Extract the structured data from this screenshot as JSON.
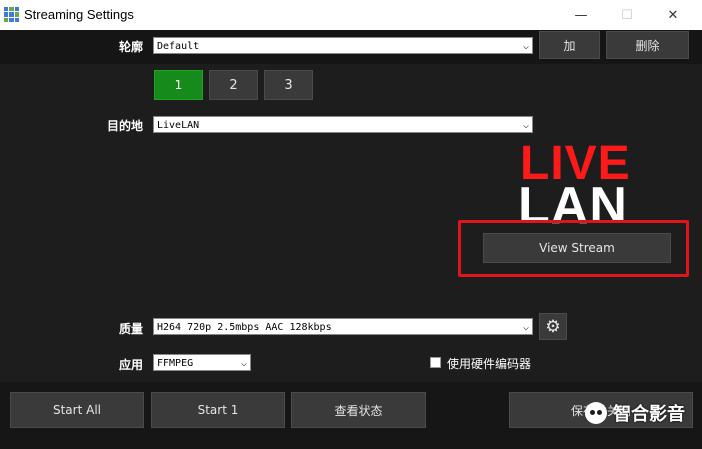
{
  "window": {
    "title": "Streaming Settings",
    "minimize": "—",
    "maximize": "☐",
    "close": "✕"
  },
  "profile": {
    "label": "轮廓",
    "value": "Default",
    "add_label": "加",
    "delete_label": "删除"
  },
  "tabs": [
    "1",
    "2",
    "3"
  ],
  "destination": {
    "label": "目的地",
    "value": "LiveLAN"
  },
  "logo": {
    "line1": "LIVE",
    "line2": "LAN"
  },
  "view_stream_label": "View Stream",
  "quality": {
    "label": "质量",
    "value": "H264 720p 2.5mbps AAC 128kbps"
  },
  "application": {
    "label": "应用",
    "value": "FFMPEG"
  },
  "hardware_encoder_label": "使用硬件编码器",
  "bottom": {
    "start_all": "Start All",
    "start_1": "Start 1",
    "view_status": "查看状态",
    "save_close": "保存并关闭"
  },
  "watermark_text": "智合影音",
  "colors": {
    "tab_active": "#168a1b",
    "logo_red": "#ff1a1a",
    "highlight_border": "#e0141b"
  }
}
